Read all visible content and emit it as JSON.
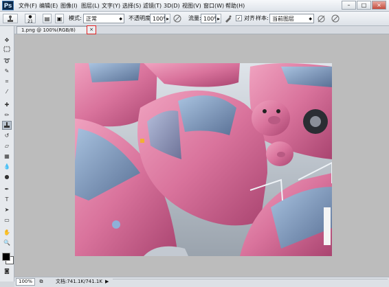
{
  "app": {
    "logo": "Ps"
  },
  "menu": [
    "文件(F)",
    "编辑(E)",
    "图像(I)",
    "图层(L)",
    "文字(Y)",
    "选择(S)",
    "滤镜(T)",
    "3D(D)",
    "视图(V)",
    "窗口(W)",
    "帮助(H)"
  ],
  "window_controls": {
    "minimize": "–",
    "maximize": "□",
    "close": "×"
  },
  "options": {
    "brush_size": "21",
    "mode_label": "模式:",
    "mode_value": "正常",
    "opacity_label": "不透明度:",
    "opacity_value": "100%",
    "flow_label": "流量:",
    "flow_value": "100%",
    "aligned_label": "对齐",
    "aligned_checked": "✓",
    "sample_label": "样本:",
    "sample_value": "当前图层"
  },
  "document": {
    "tab_title": "1.png @ 100%(RGB/8)",
    "tab_close": "×"
  },
  "tools": [
    "move-tool",
    "marquee-tool",
    "lasso-tool",
    "quick-select-tool",
    "crop-tool",
    "eyedropper-tool",
    "healing-brush-tool",
    "brush-tool",
    "clone-stamp-tool",
    "history-brush-tool",
    "eraser-tool",
    "gradient-tool",
    "blur-tool",
    "dodge-tool",
    "pen-tool",
    "type-tool",
    "path-select-tool",
    "shape-tool",
    "hand-tool",
    "zoom-tool"
  ],
  "status": {
    "zoom": "100%",
    "doc_info": "文档:741.1K/741.1K"
  },
  "colors": {
    "car_pink": "#d9739c",
    "accent_red": "#e02020"
  }
}
